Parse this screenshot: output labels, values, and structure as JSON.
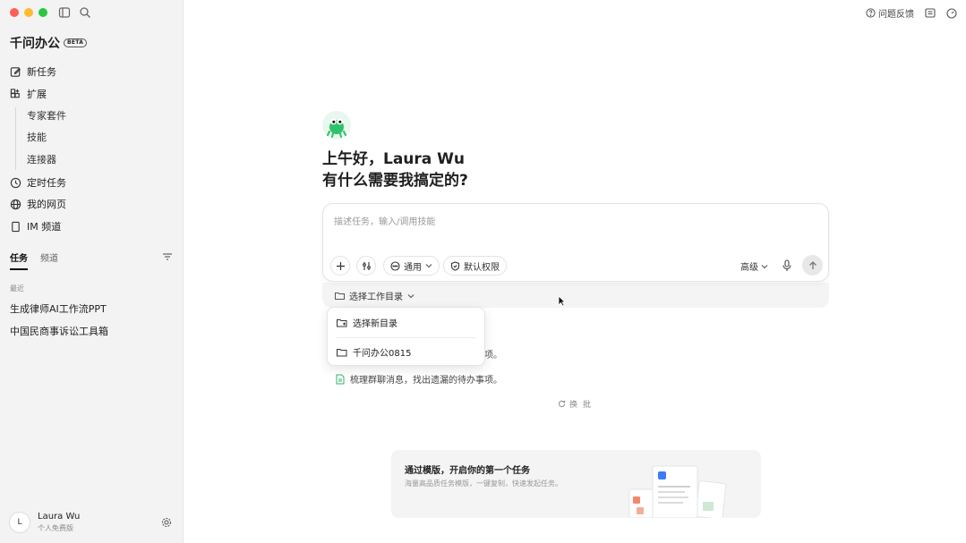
{
  "sidebar": {
    "brand": "千问办公",
    "badge": "BETA",
    "nav": [
      {
        "label": "新任务",
        "icon": "edit-icon"
      },
      {
        "label": "扩展",
        "icon": "grid-plus-icon"
      }
    ],
    "sub_items": [
      "专家套件",
      "技能",
      "连接器"
    ],
    "nav2": [
      {
        "label": "定时任务",
        "icon": "clock-icon"
      },
      {
        "label": "我的网页",
        "icon": "globe-icon"
      },
      {
        "label": "IM 频道",
        "icon": "phone-icon"
      }
    ],
    "tabs": [
      "任务",
      "频道"
    ],
    "recent_label": "最近",
    "recent": [
      "生成律师AI工作流PPT",
      "中国民商事诉讼工具箱"
    ],
    "user": {
      "initial": "L",
      "name": "Laura Wu",
      "plan": "个人免费版"
    }
  },
  "topbar": {
    "feedback": "问题反馈"
  },
  "main": {
    "greeting1": "上午好，Laura Wu",
    "greeting2": "有什么需要我搞定的?",
    "input_placeholder": "描述任务，输入/调用技能",
    "mode_label": "通用",
    "permission_label": "默认权限",
    "advanced_label": "高级",
    "dir_label": "选择工作目录",
    "dropdown": {
      "new_dir": "选择新目录",
      "recent_dir": "千问办公0815"
    },
    "partial_text": "项。",
    "suggestion": "梳理群聊消息，找出遗漏的待办事项。",
    "refresh": "换批",
    "template": {
      "title": "通过模版，开启你的第一个任务",
      "subtitle": "海量高品质任务模版，一键复制，快速发起任务。"
    }
  }
}
